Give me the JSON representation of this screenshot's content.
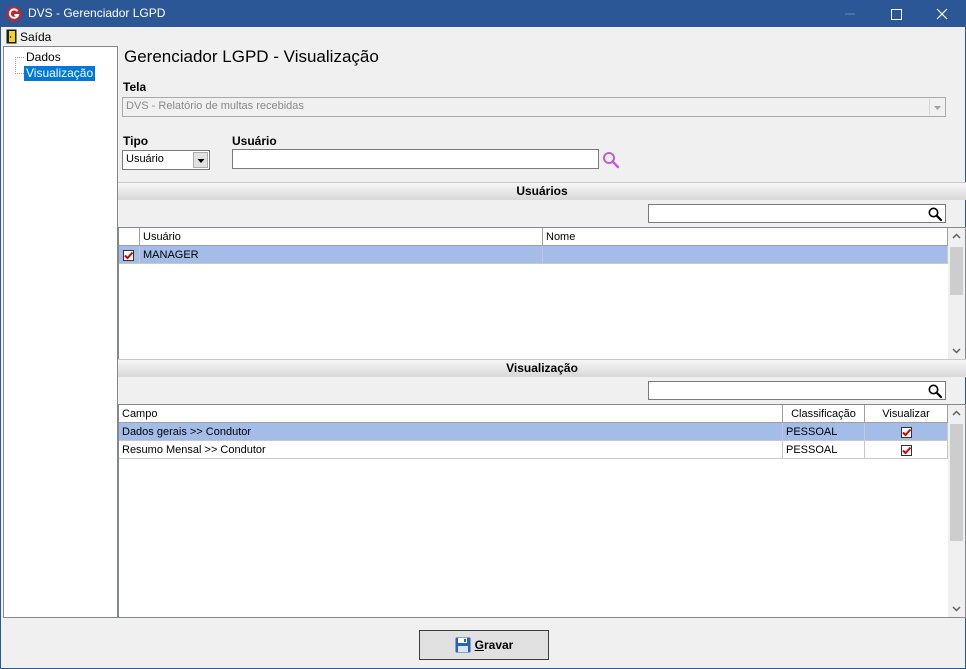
{
  "window": {
    "title": "DVS - Gerenciador LGPD"
  },
  "menu": {
    "exit_label": "Saída"
  },
  "tree": {
    "items": [
      {
        "label": "Dados"
      },
      {
        "label": "Visualização"
      }
    ]
  },
  "page": {
    "title": "Gerenciador LGPD - Visualização"
  },
  "form": {
    "screen_label": "Tela",
    "screen_value": "DVS - Relatório de multas recebidas",
    "type_label": "Tipo",
    "type_value": "Usuário",
    "user_label": "Usuário",
    "user_value": ""
  },
  "users_section": {
    "title": "Usuários",
    "filter_value": "",
    "columns": [
      "Usuário",
      "Nome"
    ],
    "rows": [
      {
        "user": "MANAGER",
        "name": "",
        "checked": true
      }
    ]
  },
  "view_section": {
    "title": "Visualização",
    "filter_value": "",
    "columns": [
      "Campo",
      "Classificação",
      "Visualizar"
    ],
    "rows": [
      {
        "field": "Dados gerais >> Condutor",
        "classification": "PESSOAL",
        "visible": true
      },
      {
        "field": "Resumo Mensal >> Condutor",
        "classification": "PESSOAL",
        "visible": true
      }
    ]
  },
  "footer": {
    "save_label": "Gravar"
  },
  "colors": {
    "titlebar": "#2b5797",
    "selection_row": "#a4bde8",
    "tree_selection": "#0078d7",
    "check": "#d40000"
  }
}
